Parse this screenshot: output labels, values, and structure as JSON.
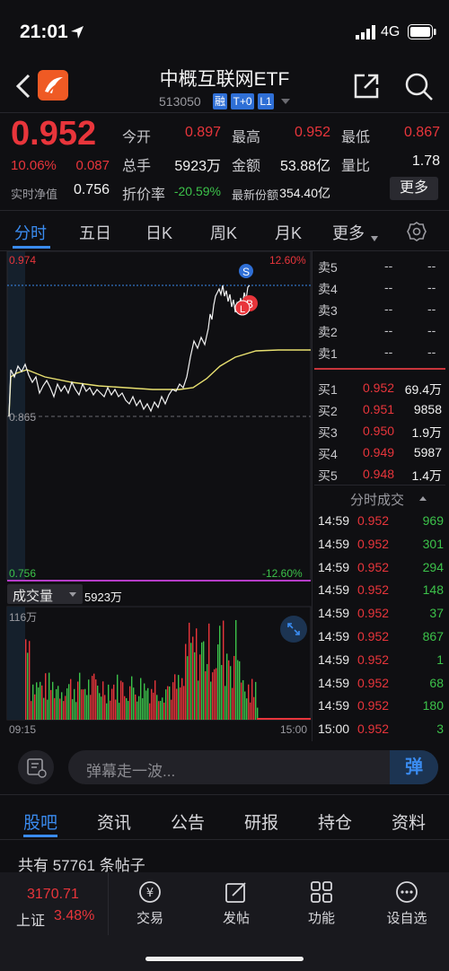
{
  "status_bar": {
    "time": "21:01",
    "network": "4G"
  },
  "header": {
    "title": "中概互联网ETF",
    "code": "513050",
    "tags": [
      "融",
      "T+0",
      "L1"
    ]
  },
  "quote": {
    "price": "0.952",
    "change_pct": "10.06%",
    "change_amt": "0.087",
    "nav_label": "实时净值",
    "nav_value": "0.756",
    "open_label": "今开",
    "open_value": "0.897",
    "high_label": "最高",
    "high_value": "0.952",
    "low_label": "最低",
    "low_value": "0.867",
    "volume_label": "总手",
    "volume_value": "5923万",
    "amount_label": "金额",
    "amount_value": "53.88亿",
    "ratio_label": "量比",
    "ratio_value": "1.78",
    "discount_label": "折价率",
    "discount_value": "-20.59%",
    "shares_label": "最新份额",
    "shares_value": "354.40亿",
    "more_label": "更多"
  },
  "chart_tabs": [
    "分时",
    "五日",
    "日K",
    "周K",
    "月K",
    "更多"
  ],
  "intraday": {
    "top_price": "0.974",
    "top_pct": "12.60%",
    "mid_price": "0.865",
    "bottom_price": "0.756",
    "bottom_pct": "-12.60%",
    "time_start": "09:15",
    "time_end": "15:00",
    "markers": [
      "S",
      "B",
      "L"
    ]
  },
  "volume_panel": {
    "label": "成交量",
    "value": "5923万",
    "max": "116万"
  },
  "order_book": {
    "asks": [
      {
        "label": "卖5",
        "price": "--",
        "vol": "--"
      },
      {
        "label": "卖4",
        "price": "--",
        "vol": "--"
      },
      {
        "label": "卖3",
        "price": "--",
        "vol": "--"
      },
      {
        "label": "卖2",
        "price": "--",
        "vol": "--"
      },
      {
        "label": "卖1",
        "price": "--",
        "vol": "--"
      }
    ],
    "bids": [
      {
        "label": "买1",
        "price": "0.952",
        "vol": "69.4万"
      },
      {
        "label": "买2",
        "price": "0.951",
        "vol": "9858"
      },
      {
        "label": "买3",
        "price": "0.950",
        "vol": "1.9万"
      },
      {
        "label": "买4",
        "price": "0.949",
        "vol": "5987"
      },
      {
        "label": "买5",
        "price": "0.948",
        "vol": "1.4万"
      }
    ]
  },
  "ticks_title": "分时成交",
  "ticks": [
    {
      "time": "14:59",
      "price": "0.952",
      "vol": "969"
    },
    {
      "time": "14:59",
      "price": "0.952",
      "vol": "301"
    },
    {
      "time": "14:59",
      "price": "0.952",
      "vol": "294"
    },
    {
      "time": "14:59",
      "price": "0.952",
      "vol": "148"
    },
    {
      "time": "14:59",
      "price": "0.952",
      "vol": "37"
    },
    {
      "time": "14:59",
      "price": "0.952",
      "vol": "867"
    },
    {
      "time": "14:59",
      "price": "0.952",
      "vol": "1"
    },
    {
      "time": "14:59",
      "price": "0.952",
      "vol": "68"
    },
    {
      "time": "14:59",
      "price": "0.952",
      "vol": "180"
    },
    {
      "time": "15:00",
      "price": "0.952",
      "vol": "3"
    }
  ],
  "comment": {
    "placeholder": "弹幕走一波...",
    "button": "弹"
  },
  "news_tabs": [
    "股吧",
    "资讯",
    "公告",
    "研报",
    "持仓",
    "资料"
  ],
  "post_count": "共有 57761 条帖子",
  "bottom_bar": {
    "index_value": "3170.71",
    "index_name": "上证",
    "index_pct": "3.48%",
    "items": [
      "交易",
      "发帖",
      "功能",
      "设自选"
    ]
  },
  "colors": {
    "up": "#e8353b",
    "down": "#3cc24a",
    "accent": "#3a8bef",
    "background": "#0f0f12"
  }
}
